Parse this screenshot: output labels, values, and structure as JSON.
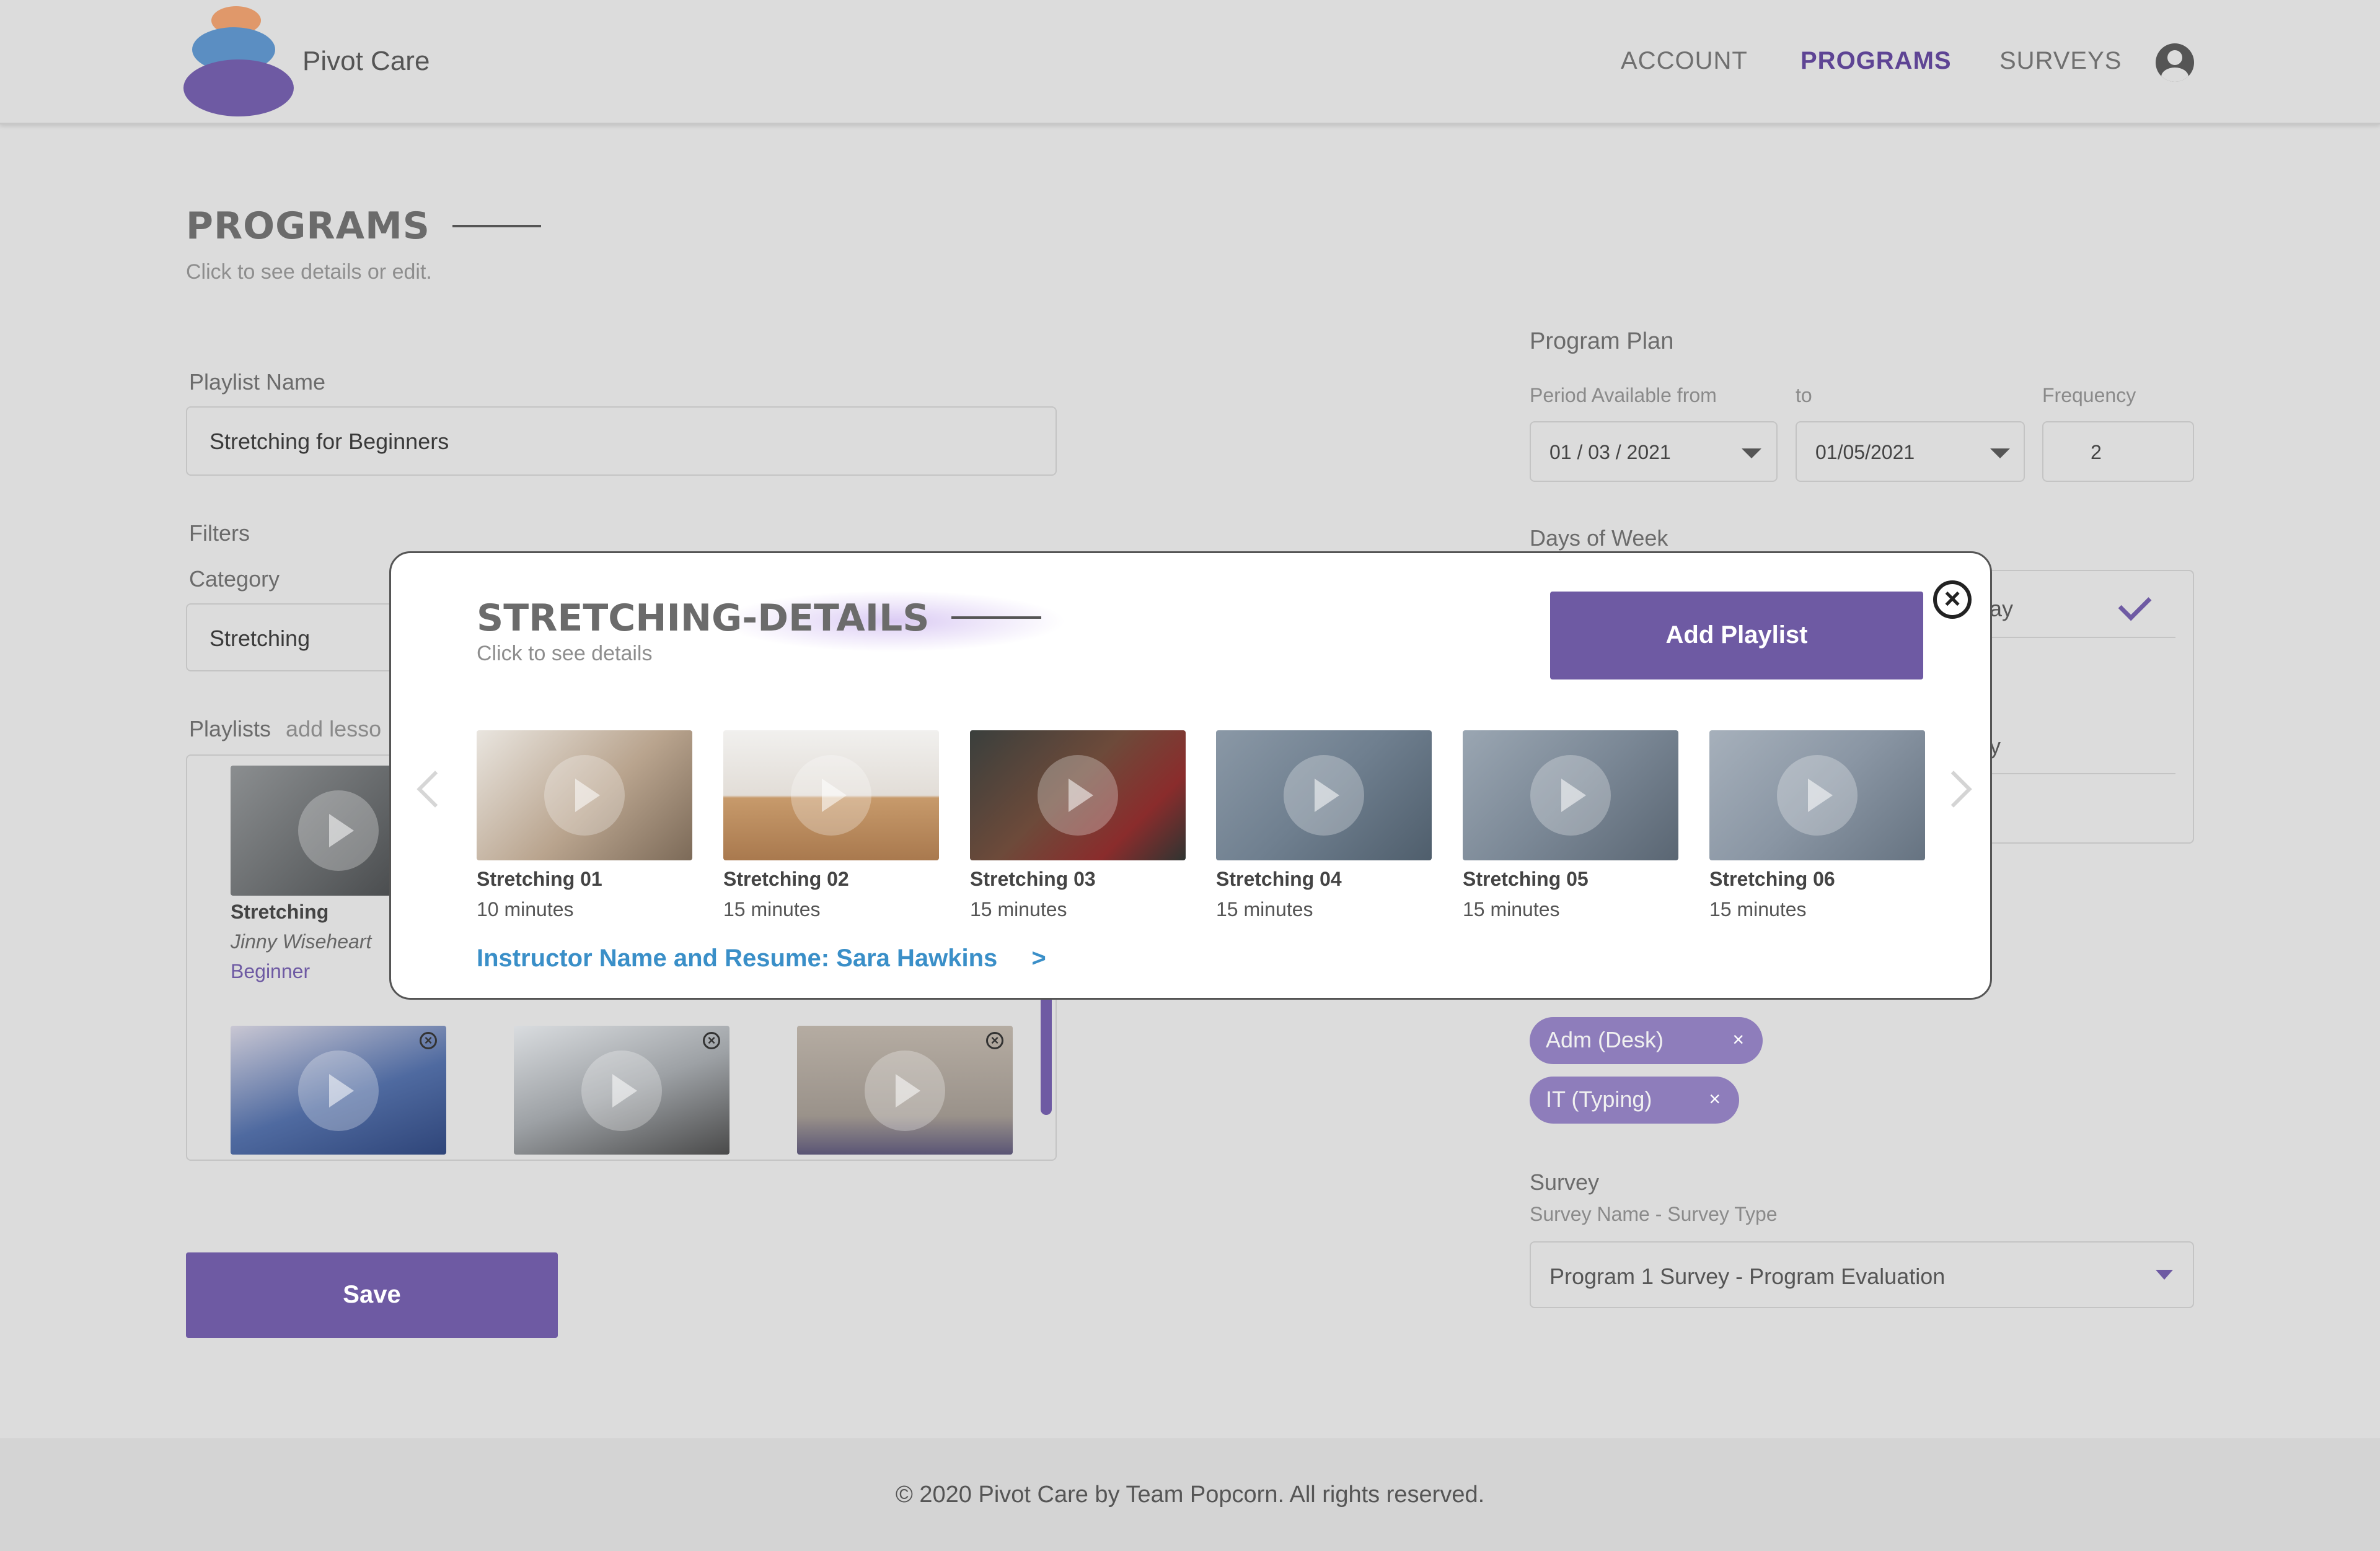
{
  "header": {
    "brand": "Pivot Care",
    "nav": [
      {
        "label": "ACCOUNT",
        "active": false
      },
      {
        "label": "PROGRAMS",
        "active": true
      },
      {
        "label": "SURVEYS",
        "active": false
      }
    ]
  },
  "page": {
    "title": "PROGRAMS",
    "subtitle": "Click to see details or edit."
  },
  "form": {
    "playlist_name_label": "Playlist  Name",
    "playlist_name_value": "Stretching  for Beginners",
    "filters_label": "Filters",
    "category_label": "Category",
    "category_value": "Stretching",
    "playlists_label": "Playlists",
    "playlists_hint": "add lesso",
    "playlist_card": {
      "title": "Stretching",
      "instructor": "Jinny Wiseheart",
      "level": "Beginner"
    },
    "save_label": "Save"
  },
  "program_plan": {
    "title": "Program Plan",
    "period_label": "Period Available from",
    "to_label": "to",
    "frequency_label": "Frequency",
    "from_value": "01 / 03 / 2021",
    "to_value": "01/05/2021",
    "frequency_value": "2",
    "days_label": "Days of Week",
    "days_partial": [
      "ay",
      "y"
    ],
    "tags": [
      {
        "label": "Adm (Desk)"
      },
      {
        "label": "IT (Typing)"
      }
    ],
    "survey_label": "Survey",
    "survey_sub": "Survey Name - Survey Type",
    "survey_value": "Program 1 Survey - Program Evaluation"
  },
  "modal": {
    "title": "STRETCHING-DETAILS",
    "subtitle": "Click to see details",
    "add_playlist_label": "Add Playlist",
    "instructor_link": "Instructor Name and Resume: Sara Hawkins",
    "instructor_arrow": ">",
    "videos": [
      {
        "title": "Stretching 01",
        "duration": "10 minutes",
        "color": "#b9a48e"
      },
      {
        "title": "Stretching 02",
        "duration": "15 minutes",
        "color": "#c79a6b"
      },
      {
        "title": "Stretching 03",
        "duration": "15 minutes",
        "color": "#6d4a3a"
      },
      {
        "title": "Stretching 04",
        "duration": "15 minutes",
        "color": "#6f7f8f"
      },
      {
        "title": "Stretching 05",
        "duration": "15 minutes",
        "color": "#7b8896"
      },
      {
        "title": "Stretching 06",
        "duration": "15 minutes",
        "color": "#8a96a4"
      }
    ]
  },
  "footer": {
    "text": "©  2020 Pivot Care by Team Popcorn. All rights reserved."
  },
  "colors": {
    "brand_purple": "#6e5aa3",
    "link_blue": "#3a8fc8",
    "background": "#dcdcdc"
  }
}
